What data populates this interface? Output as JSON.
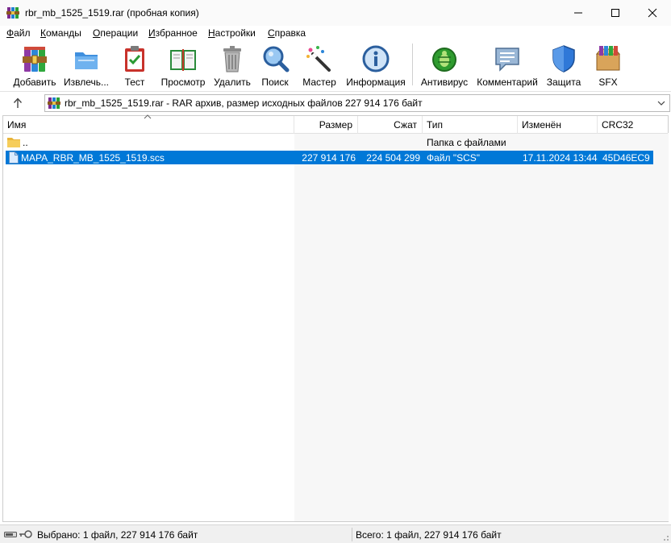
{
  "window": {
    "title": "rbr_mb_1525_1519.rar (пробная копия)",
    "controls": {
      "minimize": "minimize",
      "maximize": "maximize",
      "close": "close"
    }
  },
  "menu": [
    {
      "access_key": "Ф",
      "rest": "айл"
    },
    {
      "access_key": "К",
      "rest": "оманды"
    },
    {
      "access_key": "О",
      "rest": "перации"
    },
    {
      "access_key": "И",
      "rest": "збранное"
    },
    {
      "access_key": "Н",
      "rest": "астройки"
    },
    {
      "access_key": "С",
      "rest": "правка"
    }
  ],
  "toolbar": [
    {
      "label": "Добавить",
      "icon": "add-archive-icon"
    },
    {
      "label": "Извлечь...",
      "icon": "extract-folder-icon"
    },
    {
      "label": "Тест",
      "icon": "test-clipboard-icon"
    },
    {
      "label": "Просмотр",
      "icon": "view-book-icon"
    },
    {
      "label": "Удалить",
      "icon": "trash-icon"
    },
    {
      "label": "Поиск",
      "icon": "magnifier-icon"
    },
    {
      "label": "Мастер",
      "icon": "wizard-wand-icon"
    },
    {
      "label": "Информация",
      "icon": "info-icon"
    },
    {
      "label": "Антивирус",
      "icon": "antivirus-bug-icon"
    },
    {
      "label": "Комментарий",
      "icon": "comment-icon"
    },
    {
      "label": "Защита",
      "icon": "shield-icon"
    },
    {
      "label": "SFX",
      "icon": "sfx-box-icon"
    }
  ],
  "address": {
    "text": "rbr_mb_1525_1519.rar - RAR архив, размер исходных файлов 227 914 176 байт"
  },
  "columns": {
    "name": "Имя",
    "size": "Размер",
    "packed": "Сжат",
    "type": "Тип",
    "modified": "Изменён",
    "crc": "CRC32"
  },
  "rows": [
    {
      "name": "..",
      "size": "",
      "packed": "",
      "type": "Папка с файлами",
      "modified": "",
      "crc": "",
      "icon": "folder-icon",
      "selected": false
    },
    {
      "name": "MAPA_RBR_MB_1525_1519.scs",
      "size": "227 914 176",
      "packed": "224 504 299",
      "type": "Файл \"SCS\"",
      "modified": "17.11.2024 13:44",
      "crc": "45D46EC9",
      "icon": "file-icon",
      "selected": true
    }
  ],
  "status": {
    "left": "Выбрано: 1 файл, 227 914 176 байт",
    "right": "Всего: 1 файл, 227 914 176 байт"
  },
  "colors": {
    "selection": "#0078d7",
    "title_bg": "#fafafa",
    "status_bg": "#f0f0f0"
  }
}
